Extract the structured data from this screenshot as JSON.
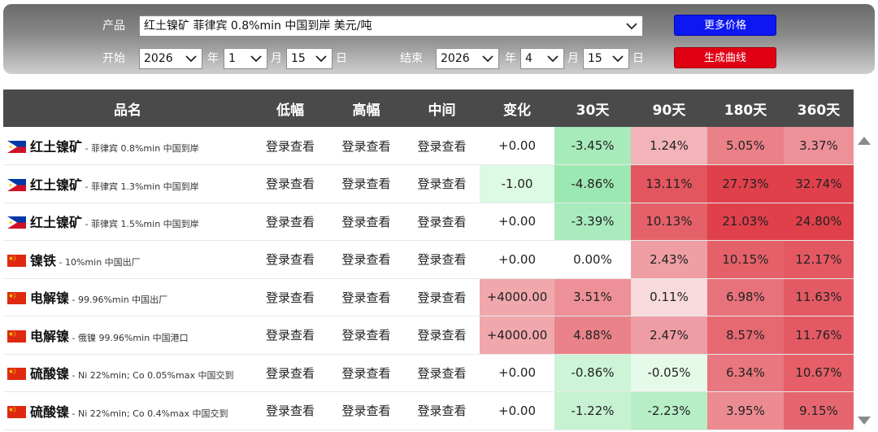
{
  "filters": {
    "product_label": "产品",
    "product_value": "红土镍矿 菲律宾 0.8%min 中国到岸 美元/吨",
    "start_label": "开始",
    "end_label": "结束",
    "start": {
      "year": "2026",
      "month": "1",
      "day": "15"
    },
    "end": {
      "year": "2026",
      "month": "4",
      "day": "15"
    },
    "unit_year": "年",
    "unit_month": "月",
    "unit_day": "日",
    "more_prices_button": "更多价格",
    "make_curve_button": "生成曲线"
  },
  "table": {
    "headers": [
      "品名",
      "低幅",
      "高幅",
      "中间",
      "变化",
      "30天",
      "90天",
      "180天",
      "360天"
    ],
    "rows": [
      {
        "flag": "philippines-flag",
        "name": "红土镍矿",
        "desc": "菲律宾 0.8%min 中国到岸",
        "low": "登录查看",
        "high": "登录查看",
        "mid": "登录查看",
        "change": "+0.00",
        "d30": "-3.45%",
        "d90": "1.24%",
        "d180": "5.05%",
        "d360": "3.37%"
      },
      {
        "flag": "philippines-flag",
        "name": "红土镍矿",
        "desc": "菲律宾 1.3%min 中国到岸",
        "low": "登录查看",
        "high": "登录查看",
        "mid": "登录查看",
        "change": "-1.00",
        "d30": "-4.86%",
        "d90": "13.11%",
        "d180": "27.73%",
        "d360": "32.74%"
      },
      {
        "flag": "philippines-flag",
        "name": "红土镍矿",
        "desc": "菲律宾 1.5%min 中国到岸",
        "low": "登录查看",
        "high": "登录查看",
        "mid": "登录查看",
        "change": "+0.00",
        "d30": "-3.39%",
        "d90": "10.13%",
        "d180": "21.03%",
        "d360": "24.80%"
      },
      {
        "flag": "china-flag",
        "name": "镍铁",
        "desc": "10%min 中国出厂",
        "low": "登录查看",
        "high": "登录查看",
        "mid": "登录查看",
        "change": "+0.00",
        "d30": "0.00%",
        "d90": "2.43%",
        "d180": "10.15%",
        "d360": "12.17%"
      },
      {
        "flag": "china-flag",
        "name": "电解镍",
        "desc": "99.96%min 中国出厂",
        "low": "登录查看",
        "high": "登录查看",
        "mid": "登录查看",
        "change": "+4000.00",
        "d30": "3.51%",
        "d90": "0.11%",
        "d180": "6.98%",
        "d360": "11.63%"
      },
      {
        "flag": "china-flag",
        "name": "电解镍",
        "desc": "俄镍 99.96%min 中国港口",
        "low": "登录查看",
        "high": "登录查看",
        "mid": "登录查看",
        "change": "+4000.00",
        "d30": "4.88%",
        "d90": "2.47%",
        "d180": "8.57%",
        "d360": "11.76%"
      },
      {
        "flag": "china-flag",
        "name": "硫酸镍",
        "desc": "Ni 22%min; Co 0.05%max 中国交到",
        "low": "登录查看",
        "high": "登录查看",
        "mid": "登录查看",
        "change": "+0.00",
        "d30": "-0.86%",
        "d90": "-0.05%",
        "d180": "6.34%",
        "d360": "10.67%"
      },
      {
        "flag": "china-flag",
        "name": "硫酸镍",
        "desc": "Ni 22%min; Co 0.4%max 中国交到",
        "low": "登录查看",
        "high": "登录查看",
        "mid": "登录查看",
        "change": "+0.00",
        "d30": "-1.22%",
        "d90": "-2.23%",
        "d180": "3.95%",
        "d360": "9.15%"
      }
    ]
  },
  "colors": {
    "header_bg": "#4a4a4a",
    "button_blue": "#0d17f2",
    "button_red": "#e00014",
    "increase": "#e0404f",
    "decrease": "#3fcf6a"
  }
}
